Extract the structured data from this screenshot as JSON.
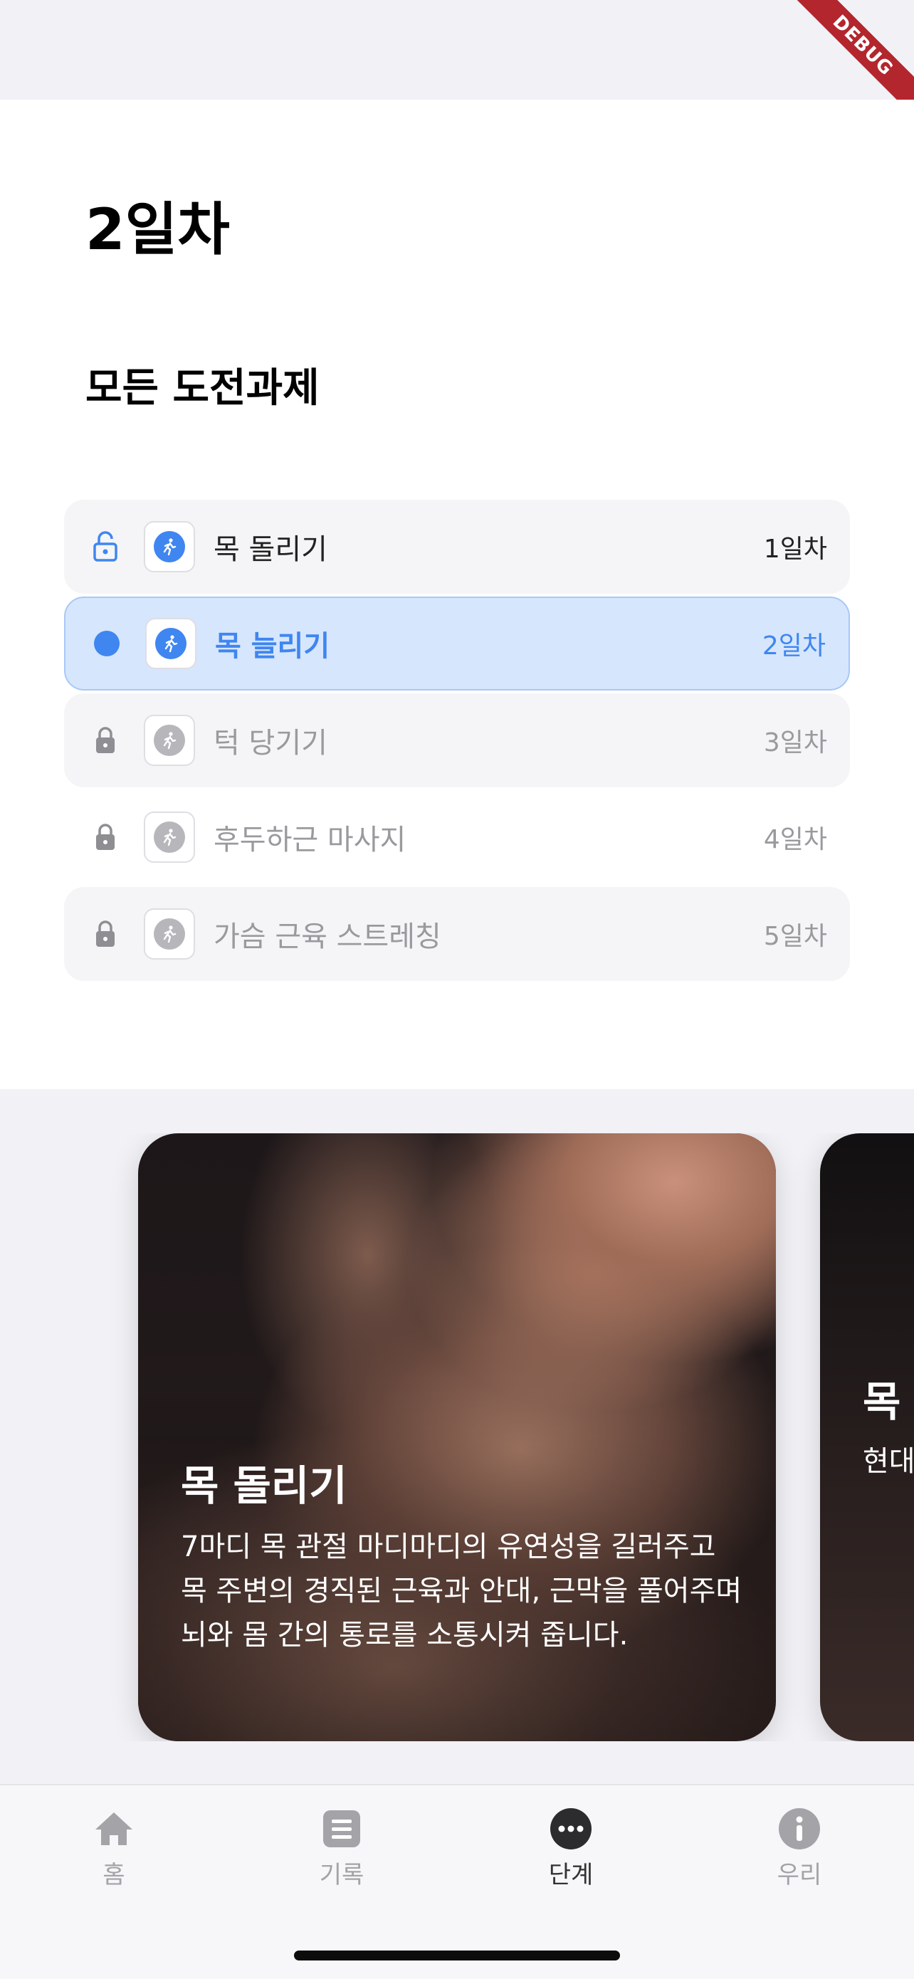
{
  "debug_banner": "DEBUG",
  "header": {
    "day_title": "2일차"
  },
  "section_title": "모든 도전과제",
  "challenges": [
    {
      "label": "목 돌리기",
      "day": "1일차",
      "state": "unlocked",
      "lead_icon": "lock-open-icon",
      "task_icon": "run-icon"
    },
    {
      "label": "목 늘리기",
      "day": "2일차",
      "state": "current",
      "lead_icon": "dot-indicator",
      "task_icon": "run-icon"
    },
    {
      "label": "턱 당기기",
      "day": "3일차",
      "state": "locked",
      "lead_icon": "lock-icon",
      "task_icon": "run-icon"
    },
    {
      "label": "후두하근 마사지",
      "day": "4일차",
      "state": "locked",
      "lead_icon": "lock-icon",
      "task_icon": "run-icon"
    },
    {
      "label": "가슴 근육 스트레칭",
      "day": "5일차",
      "state": "locked",
      "lead_icon": "lock-icon",
      "task_icon": "run-icon"
    }
  ],
  "cards": [
    {
      "title": "목 돌리기",
      "description": "7마디 목 관절 마디마디의 유연성을 길러주고 목 주변의 경직된 근육과 안대, 근막을 풀어주며 뇌와 몸 간의 통로를 소통시켜 줍니다."
    },
    {
      "title": "목 늘리기",
      "description": "현대인 북목 가진 다. 잘 는 약 움을"
    }
  ],
  "tabs": [
    {
      "label": "홈",
      "icon": "home-icon",
      "active": false
    },
    {
      "label": "기록",
      "icon": "document-icon",
      "active": false
    },
    {
      "label": "단계",
      "icon": "more-dots-icon",
      "active": true
    },
    {
      "label": "우리",
      "icon": "info-icon",
      "active": false
    }
  ],
  "colors": {
    "accent": "#3f86f0",
    "active_row_bg": "#d6e6fd",
    "inactive_text": "#9a9a9e",
    "debug_banner": "#b3262d"
  }
}
